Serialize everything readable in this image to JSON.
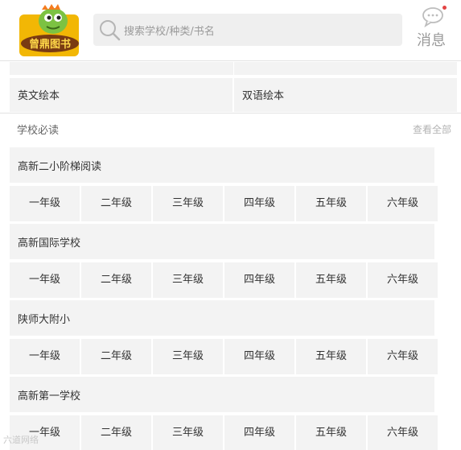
{
  "header": {
    "logo_text": "曾鼎图书",
    "search_placeholder": "搜索学校/种类/书名",
    "message_label": "消息"
  },
  "categories": {
    "row": [
      "英文绘本",
      "双语绘本"
    ]
  },
  "section": {
    "title": "学校必读",
    "more_label": "查看全部"
  },
  "schools": [
    {
      "name": "高新二小阶梯阅读",
      "grades": [
        "一年级",
        "二年级",
        "三年级",
        "四年级",
        "五年级",
        "六年级"
      ]
    },
    {
      "name": "高新国际学校",
      "grades": [
        "一年级",
        "二年级",
        "三年级",
        "四年级",
        "五年级",
        "六年级"
      ]
    },
    {
      "name": "陕师大附小",
      "grades": [
        "一年级",
        "二年级",
        "三年级",
        "四年级",
        "五年级",
        "六年级"
      ]
    },
    {
      "name": "高新第一学校",
      "grades": [
        "一年级",
        "二年级",
        "三年级",
        "四年级",
        "五年级",
        "六年级"
      ]
    }
  ],
  "colors": {
    "accent": "#f2b705",
    "notification_dot": "#e34444",
    "cell_background": "#f3f3f3"
  },
  "watermark": "六道网络"
}
